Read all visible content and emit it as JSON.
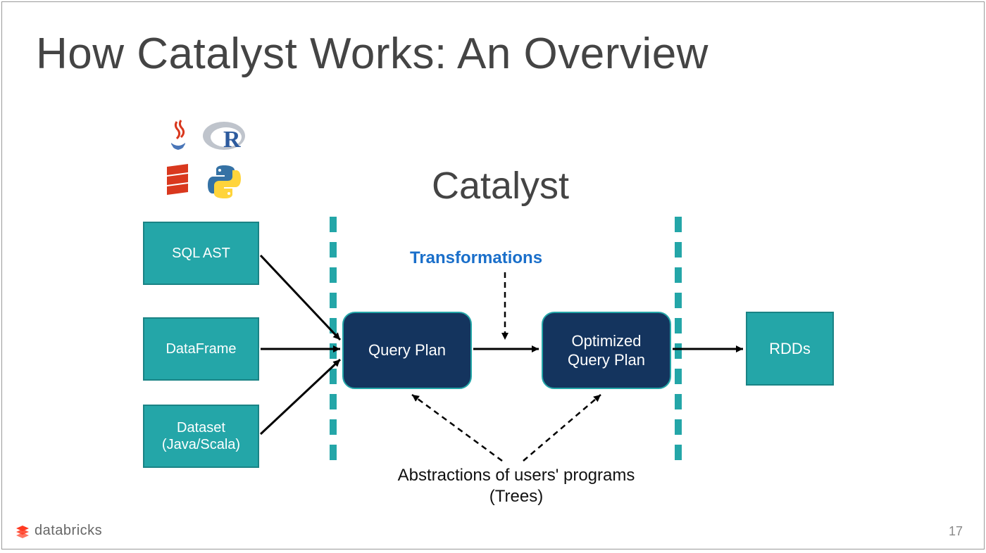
{
  "slide": {
    "title": "How Catalyst Works: An Overview",
    "catalyst_label": "Catalyst",
    "transformations_label": "Transformations",
    "abstractions_line1": "Abstractions of users' programs",
    "abstractions_line2": "(Trees)",
    "page_number": "17"
  },
  "boxes": {
    "sql_ast": "SQL AST",
    "dataframe": "DataFrame",
    "dataset": "Dataset\n(Java/Scala)",
    "query_plan": "Query Plan",
    "optimized_query_plan": "Optimized\nQuery Plan",
    "rdds": "RDDs"
  },
  "icons": {
    "java": "java-icon",
    "r": "r-icon",
    "scala": "scala-icon",
    "python": "python-icon"
  },
  "brand": {
    "name": "databricks"
  },
  "colors": {
    "teal": "#24a6a8",
    "teal_border": "#1a8385",
    "navy": "#14345e",
    "blue_text": "#1a6fca",
    "brand_orange": "#ff3a21",
    "title_gray": "#444444"
  }
}
